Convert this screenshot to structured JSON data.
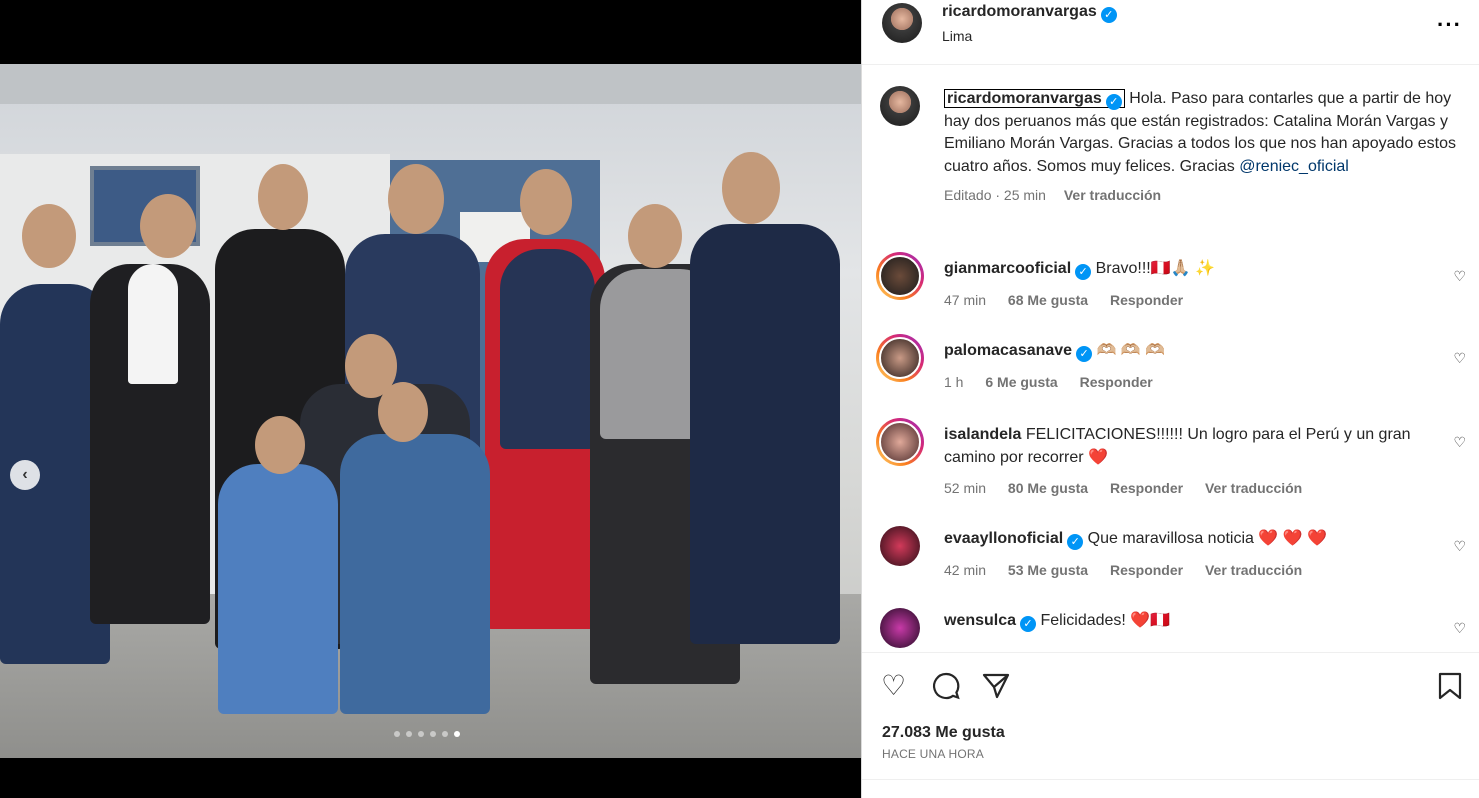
{
  "post": {
    "username": "ricardomoranvargas",
    "location": "Lima",
    "caption_user": "ricardomoranvargas",
    "caption_text": "Hola. Paso para contarles que a partir de hoy hay dos peruanos más que están registrados: Catalina Morán Vargas y Emiliano Morán Vargas. Gracias a todos los que nos han apoyado estos cuatro años. Somos muy felices. Gracias",
    "caption_mention": "@reniec_oficial",
    "edited": "Editado · 25 min",
    "translate": "Ver traducción"
  },
  "comments": [
    {
      "user": "gianmarcooficial",
      "text": "Bravo!!!",
      "emoji": "🇵🇪🙏🏼 ✨",
      "time": "47 min",
      "likes": "68 Me gusta",
      "reply": "Responder",
      "translate": ""
    },
    {
      "user": "palomacasanave",
      "text": "",
      "emoji": "🫶🏼 🫶🏼 🫶🏼",
      "time": "1 h",
      "likes": "6 Me gusta",
      "reply": "Responder",
      "translate": ""
    },
    {
      "user": "isalandela",
      "text": "FELICITACIONES!!!!!! Un logro para el Perú y un gran camino por recorrer",
      "emoji": "❤️",
      "time": "52 min",
      "likes": "80 Me gusta",
      "reply": "Responder",
      "translate": "Ver traducción"
    },
    {
      "user": "evaayllonoficial",
      "text": "Que maravillosa noticia",
      "emoji": "❤️ ❤️ ❤️",
      "time": "42 min",
      "likes": "53 Me gusta",
      "reply": "Responder",
      "translate": "Ver traducción"
    },
    {
      "user": "wensulca",
      "text": "Felicidades!",
      "emoji": "❤️🇵🇪",
      "time": "",
      "likes": "",
      "reply": "",
      "translate": ""
    }
  ],
  "footer": {
    "likes": "27.083 Me gusta",
    "ago": "HACE UNA HORA"
  },
  "carousel": {
    "slide_count": 6,
    "active_slide": 6
  },
  "icons": {
    "verified": "verified-badge-icon",
    "more": "more-options-icon",
    "like": "heart-icon",
    "comment": "comment-icon",
    "share": "share-icon",
    "save": "bookmark-icon",
    "prev": "chevron-left-icon"
  }
}
